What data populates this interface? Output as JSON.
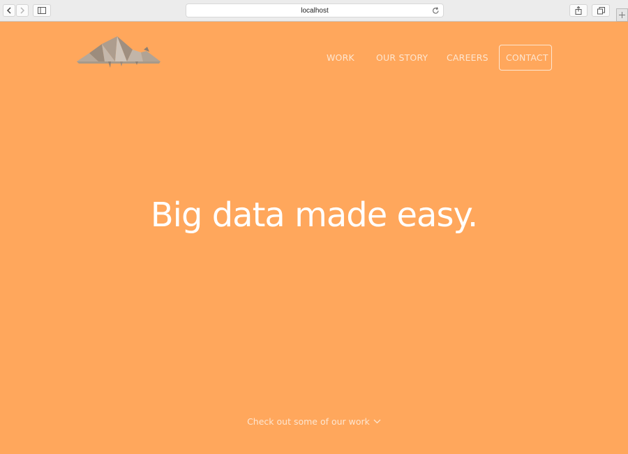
{
  "browser": {
    "url": "localhost"
  },
  "nav": {
    "items": [
      {
        "label": "WORK"
      },
      {
        "label": "OUR STORY"
      },
      {
        "label": "CAREERS"
      },
      {
        "label": "CONTACT"
      }
    ]
  },
  "hero": {
    "headline": "Big data made easy."
  },
  "cta": {
    "label": "Check out some of our work"
  },
  "colors": {
    "background": "#ffa75c",
    "nav_text": "#fde6d1",
    "headline": "#ffffff"
  },
  "icons": {
    "logo": "origami-animal-logo",
    "cta_arrow": "chevron-down-icon"
  }
}
